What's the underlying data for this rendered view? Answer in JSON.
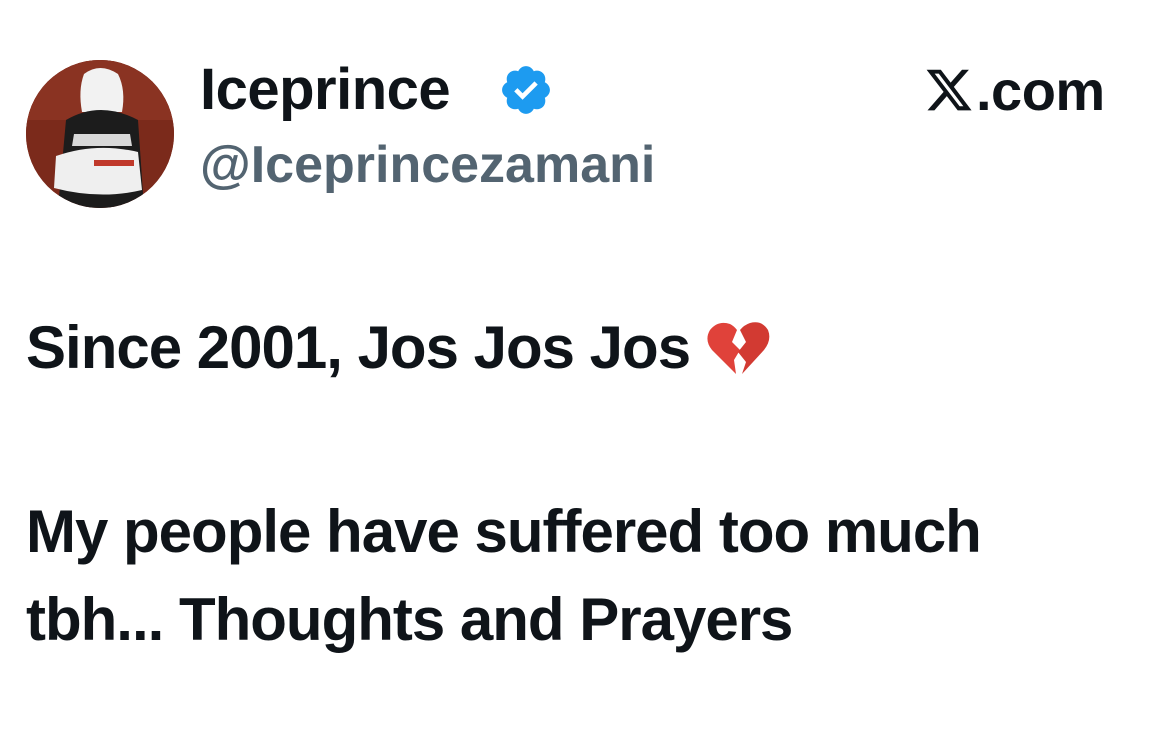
{
  "author": {
    "display_name": "Iceprince",
    "handle": "@Iceprincezamani",
    "verified_icon": "verified-badge-icon",
    "avatar_icon": "avatar-photo"
  },
  "source": {
    "logo_icon": "x-logo-icon",
    "text": ".com"
  },
  "tweet": {
    "line1": "Since 2001, Jos Jos Jos",
    "line1_emoji": "broken-heart-icon",
    "line2": "My people have suffered too much",
    "line3": "tbh...  Thoughts and Prayers"
  },
  "colors": {
    "text": "#0f1419",
    "handle": "#536471",
    "verified": "#1d9bf0",
    "broken_heart": "#e0423a"
  }
}
